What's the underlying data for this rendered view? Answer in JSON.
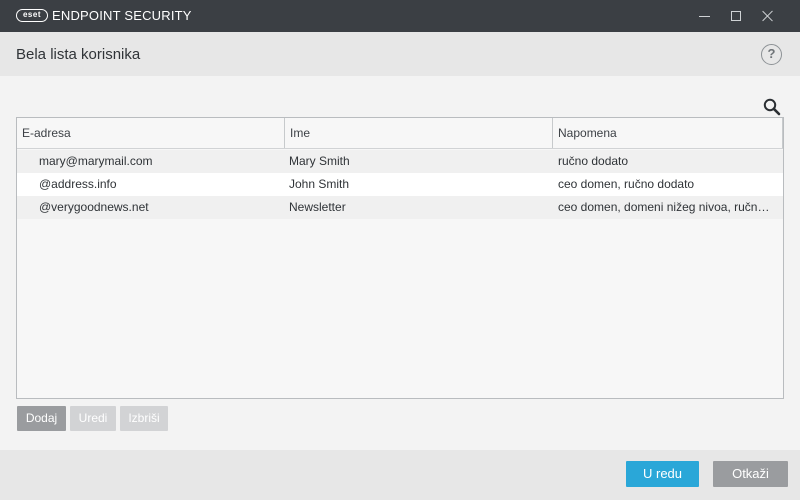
{
  "window": {
    "logo_text": "eset",
    "app_title": "ENDPOINT SECURITY",
    "controls": {
      "minimize_icon": "minimize-icon",
      "maximize_icon": "maximize-icon",
      "close_icon": "close-icon"
    }
  },
  "header": {
    "title": "Bela lista korisnika",
    "help_label": "?"
  },
  "search": {
    "icon": "search-icon"
  },
  "table": {
    "columns": [
      "E-adresa",
      "Ime",
      "Napomena"
    ],
    "rows": [
      {
        "email": "mary@marymail.com",
        "name": "Mary Smith",
        "note": "ručno dodato"
      },
      {
        "email": "@address.info",
        "name": "John Smith",
        "note": "ceo domen, ručno dodato"
      },
      {
        "email": "@verygoodnews.net",
        "name": "Newsletter",
        "note": "ceo domen, domeni nižeg nivoa, ručno dodato"
      }
    ]
  },
  "actions": {
    "add": "Dodaj",
    "edit": "Uredi",
    "delete": "Izbriši"
  },
  "footer": {
    "ok": "U redu",
    "cancel": "Otkaži"
  },
  "colors": {
    "titlebar": "#3b3f44",
    "accent": "#2aa7d8",
    "button_gray": "#9a9c9f",
    "button_disabled": "#d2d3d5"
  }
}
